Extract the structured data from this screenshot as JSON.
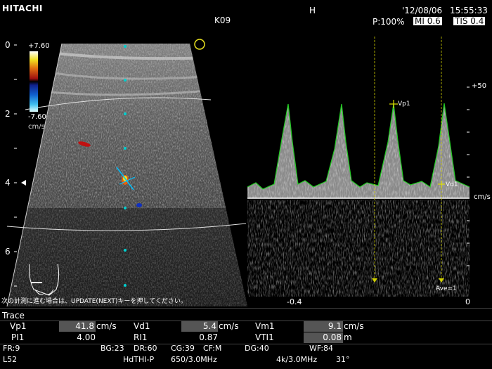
{
  "header": {
    "brand": "HITACHI",
    "probe_code": "K09",
    "mode_label": "H",
    "date": "'12/08/06",
    "time": "15:55:33",
    "power": "P:100%",
    "mi": "MI 0.6",
    "tis": "TIS 0.4"
  },
  "bmode": {
    "depth_ticks": [
      "0",
      "2",
      "4",
      "6"
    ],
    "focus_label": "H",
    "colorbar": {
      "top": "+7.60",
      "bottom": "-7.60",
      "unit": "cm/s"
    },
    "colors": {
      "flow_red": "#c01010",
      "flow_blue": "#1030c0",
      "scan_line": "#00d0d0"
    }
  },
  "doppler": {
    "scale_top": "+50",
    "unit": "cm/s",
    "time_ticks": [
      "-0.4",
      "0"
    ],
    "markers": {
      "vp": "Vp1",
      "vd": "Vd1",
      "avg": "Ave=1"
    },
    "colors": {
      "trace": "#22cc22",
      "cursor": "#e0e000"
    }
  },
  "message": "次の計測に進む場合は、UPDATE(NEXT)キーを押してください。",
  "trace": {
    "title": "Trace",
    "rows": [
      [
        {
          "label": "Vp1",
          "value": "41.8",
          "unit": "cm/s"
        },
        {
          "label": "Vd1",
          "value": "5.4",
          "unit": "cm/s"
        },
        {
          "label": "Vm1",
          "value": "9.1",
          "unit": "cm/s"
        }
      ],
      [
        {
          "label": "PI1",
          "value": "4.00",
          "unit": ""
        },
        {
          "label": "RI1",
          "value": "0.87",
          "unit": ""
        },
        {
          "label": "VTI1",
          "value": "0.08",
          "unit": "m"
        }
      ]
    ]
  },
  "settings": {
    "fr": "FR:9",
    "bg": "BG:23",
    "dr": "DR:60",
    "cg": "CG:39",
    "cf": "CF:M",
    "dg": "DG:40",
    "wf": "WF:84",
    "probe": "L52",
    "thi": "HdTHI-P",
    "freq": "650/3.0MHz",
    "doppler_freq": "4k/3.0MHz",
    "angle": "31°"
  }
}
